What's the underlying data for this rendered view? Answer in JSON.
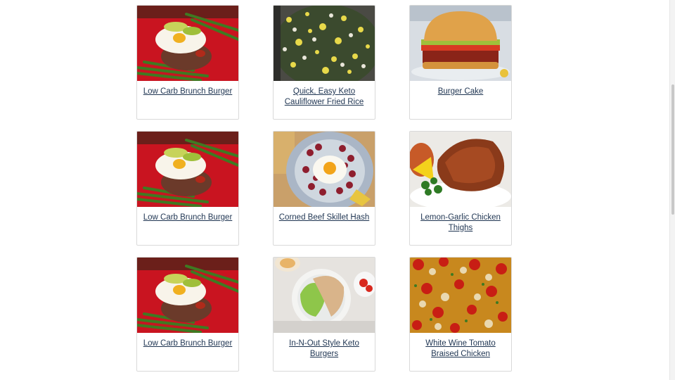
{
  "recipes": [
    {
      "title": "Low Carb Brunch Burger",
      "image": "brunch-burger-photo"
    },
    {
      "title": "Quick, Easy Keto Cauliflower Fried Rice",
      "image": "fried-rice-photo"
    },
    {
      "title": "Burger Cake",
      "image": "burger-cake-photo"
    },
    {
      "title": "Low Carb Brunch Burger",
      "image": "brunch-burger-photo"
    },
    {
      "title": "Corned Beef Skillet Hash",
      "image": "hash-photo"
    },
    {
      "title": "Lemon-Garlic Chicken Thighs",
      "image": "chicken-thighs-photo"
    },
    {
      "title": "Low Carb Brunch Burger",
      "image": "brunch-burger-photo"
    },
    {
      "title": "In-N-Out Style Keto Burgers",
      "image": "lettuce-burger-photo"
    },
    {
      "title": "White Wine Tomato Braised Chicken",
      "image": "braised-chicken-photo"
    }
  ],
  "colors": {
    "link": "#1f3552",
    "card_border": "#d9d9d9"
  }
}
